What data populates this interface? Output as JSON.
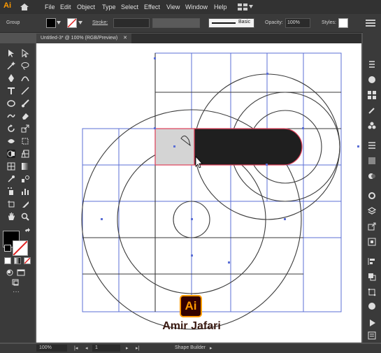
{
  "app": {
    "logo": "Ai"
  },
  "menu": [
    "File",
    "Edit",
    "Object",
    "Type",
    "Select",
    "Effect",
    "View",
    "Window",
    "Help"
  ],
  "control": {
    "selection_label": "Group",
    "stroke_label": "Stroke:",
    "brush_label": "Basic",
    "opacity_label": "Opacity:",
    "opacity_value": "100%",
    "styles_label": "Styles:"
  },
  "document": {
    "tab_title": "Untitled-3* @ 100% (RGB/Preview)"
  },
  "status": {
    "zoom": "100%",
    "artboard": "1",
    "tool": "Shape Builder"
  },
  "brand": {
    "badge": "Ai",
    "author": "Amir Jafari"
  },
  "colors": {
    "accent": "#ff9a00",
    "guide": "#5b6fd6",
    "selection": "#e0405a",
    "dark_fill": "#1f1f1f",
    "light_fill": "#d4d4d4"
  }
}
